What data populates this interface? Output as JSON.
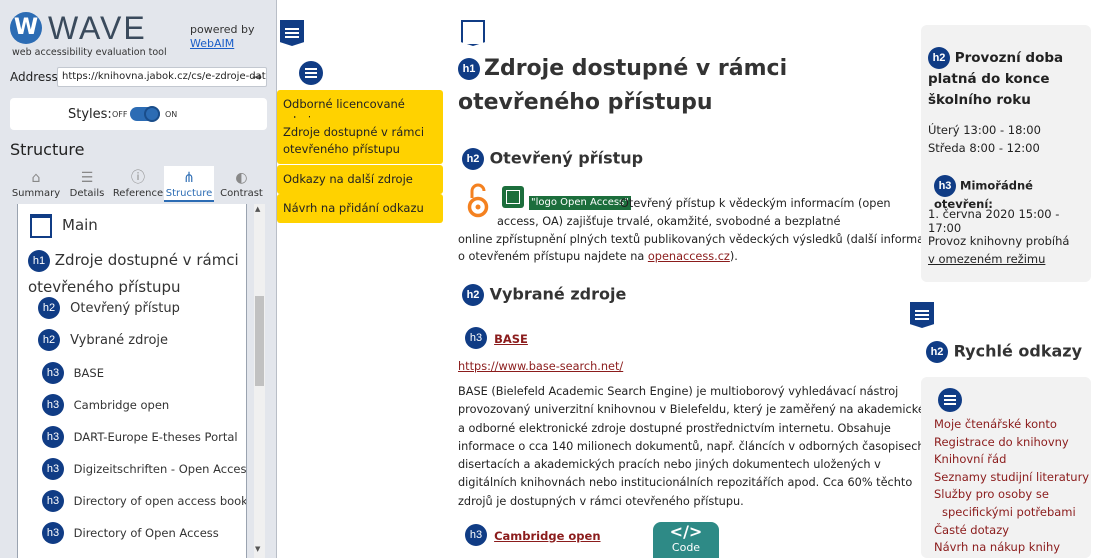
{
  "wave": {
    "title": "WAVE",
    "subtitle": "web accessibility evaluation tool",
    "powered_by": "powered by",
    "webaim": "WebAIM",
    "address_label": "Address:",
    "address_value": "https://knihovna.jabok.cz/cs/e-zdroje-datab",
    "styles_label": "Styles:",
    "styles_off": "OFF",
    "styles_on": "ON",
    "section_title": "Structure",
    "tabs": [
      {
        "label": "Summary",
        "icon": "home-icon"
      },
      {
        "label": "Details",
        "icon": "list-icon"
      },
      {
        "label": "Reference",
        "icon": "info-icon"
      },
      {
        "label": "Structure",
        "icon": "structure-icon"
      },
      {
        "label": "Contrast",
        "icon": "contrast-icon"
      }
    ],
    "structure": {
      "landmark": "Main",
      "h1": "Zdroje dostupné v rámci otevřeného přístupu",
      "h2": [
        "Otevřený přístup",
        "Vybrané zdroje"
      ],
      "h3": [
        "BASE",
        "Cambridge open",
        "DART-Europe E-theses Portal",
        "Digizeitschriften - Open Access",
        "Directory of open access books",
        "Directory of Open Access"
      ]
    }
  },
  "nav": [
    "Odborné licencované zdroje",
    "Zdroje dostupné v rámci otevřeného přístupu",
    "Odkazy na další zdroje",
    "Návrh na přidání odkazu"
  ],
  "main": {
    "h1": "Zdroje dostupné v rámci otevřeného přístupu",
    "h2_open": "Otevřený přístup",
    "alt_text": "\"logo Open Access\"",
    "open_para_1": "Otevřený přístup k vědeckým informacím (open",
    "open_para_2": "access, OA)  zajišťuje trvalé, okamžité, svobodné a bezplatné",
    "open_para_3": "online zpřístupnění plných textů publikovaných vědeckých výsledků (další informace",
    "open_para_4a": "o otevřeném přístupu najdete na ",
    "open_link": "openaccess.cz",
    "open_para_4b": ").",
    "h2_selected": "Vybrané zdroje",
    "base_title": "BASE",
    "base_url": "https://www.base-search.net/",
    "base_lines": [
      "BASE (Bielefeld Academic Search Engine) je multioborový vyhledávací nástroj",
      " provozovaný univerzitní knihovnou v Bielefeldu, který je zaměřený na akademické",
      "a odborné elektronické zdroje dostupné prostřednictvím internetu. Obsahuje",
      "informace o cca 140 milionech dokumentů, např. článcích v odborných časopisech,",
      "disertacích a akademických pracích nebo jiných  dokumentech uložených v",
      "digitálních knihovnách nebo  institucionálních repozitářích apod. Cca 60% těchto",
      "zdrojů je dostupných v rámci otevřeného přístupu."
    ],
    "cambridge_title": "Cambridge open",
    "code_label": "Code"
  },
  "sidebar": {
    "hours_title": "Provozní doba platná do konce školního roku",
    "hours": [
      "Úterý 13:00 - 18:00",
      "Středa 8:00 - 12:00"
    ],
    "extra_title": "Mimořádné otevření:",
    "extra_line": "1. června 2020 15:00 - 17:00",
    "regime_text": "Provoz knihovny probíhá",
    "regime_link": "v omezeném režimu",
    "quick_title": "Rychlé odkazy",
    "quick_links": [
      "Moje čtenářské konto",
      "Registrace do knihovny",
      "Knihovní řád",
      "Seznamy studijní literatury",
      "Služby pro osoby se",
      "specifickými potřebami",
      "Časté dotazy",
      "Návrh na nákup knihy"
    ]
  },
  "badges": {
    "h1": "h1",
    "h2": "h2",
    "h3": "h3"
  },
  "colors": {
    "badge": "#103c85",
    "nav": "#ffd200",
    "link": "#8b1c1c",
    "alt_bg": "#1c6e3c",
    "code": "#2e8a86"
  }
}
